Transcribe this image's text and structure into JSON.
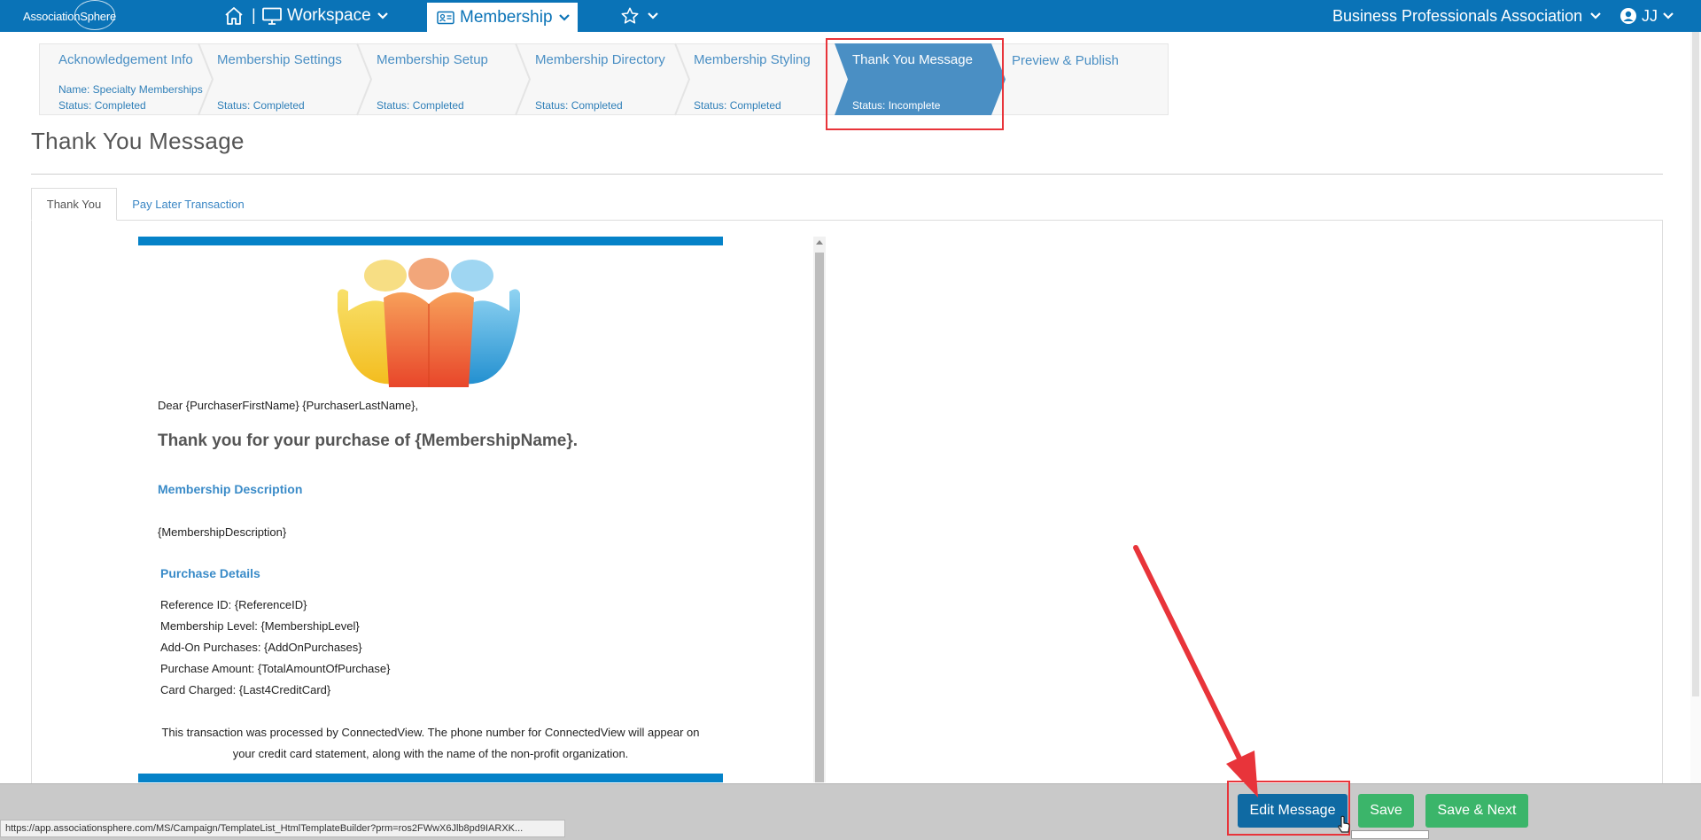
{
  "topbar": {
    "logo_text": "AssociationSphere",
    "separator": "|",
    "workspace_label": "Workspace",
    "membership_label": "Membership",
    "org_name": "Business Professionals Association",
    "user_initials": "JJ",
    "brand_color": "#0a73b7"
  },
  "steps": [
    {
      "title": "Acknowledgement Info",
      "name_line": "Name: Specialty Memberships",
      "status": "Status: Completed"
    },
    {
      "title": "Membership Settings",
      "status": "Status: Completed"
    },
    {
      "title": "Membership Setup",
      "status": "Status: Completed"
    },
    {
      "title": "Membership Directory",
      "status": "Status: Completed"
    },
    {
      "title": "Membership Styling",
      "status": "Status: Completed"
    },
    {
      "title": "Thank You Message",
      "status": "Status: Incomplete",
      "active": true
    },
    {
      "title": "Preview & Publish"
    }
  ],
  "page": {
    "title": "Thank You Message"
  },
  "tabs": [
    {
      "label": "Thank You",
      "active": true
    },
    {
      "label": "Pay Later Transaction",
      "active": false
    }
  ],
  "email": {
    "greeting": "Dear {PurchaserFirstName} {PurchaserLastName},",
    "heading": "Thank you for your purchase of {MembershipName}.",
    "description_heading": "Membership Description",
    "description_value": "{MembershipDescription}",
    "details_heading": "Purchase Details",
    "details": [
      "Reference ID: {ReferenceID}",
      "Membership Level: {MembershipLevel}",
      "Add-On Purchases: {AddOnPurchases}",
      "Purchase Amount: {TotalAmountOfPurchase}",
      "Card Charged: {Last4CreditCard}"
    ],
    "footer_note": "This transaction was processed by ConnectedView. The phone number for ConnectedView will appear on your credit card statement, along with the name of the non-profit organization.",
    "accent_color": "#0582c8"
  },
  "actions": {
    "edit_label": "Edit Message",
    "save_label": "Save",
    "save_next_label": "Save & Next"
  },
  "status_bar": {
    "url": "https://app.associationsphere.com/MS/Campaign/TemplateList_HtmlTemplateBuilder?prm=ros2FWwX6Jlb8pd9IARXK..."
  },
  "icons": {
    "home": "home-icon",
    "monitor": "monitor-icon",
    "id_card": "id-card-icon",
    "star": "star-icon",
    "user": "user-circle-icon",
    "chevron": "chevron-down-icon"
  }
}
